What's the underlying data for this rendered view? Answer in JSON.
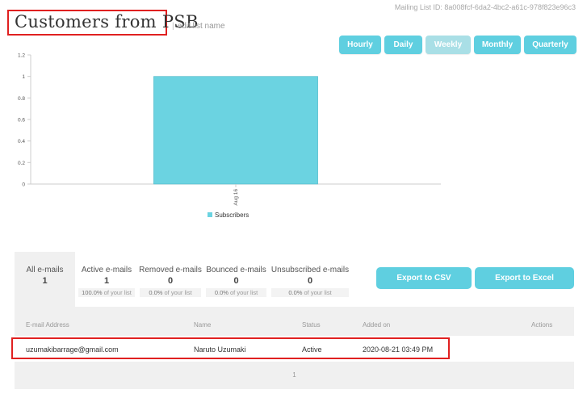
{
  "mailing_list_id": "Mailing List ID: 8a008fcf-6da2-4bc2-a61c-978f823e96c3",
  "title": "Customers from PSB",
  "edit_link": "edit list name",
  "period_buttons": [
    "Hourly",
    "Daily",
    "Weekly",
    "Monthly",
    "Quarterly"
  ],
  "period_active": "Weekly",
  "chart_data": {
    "type": "bar",
    "categories": [
      "Aug 16"
    ],
    "series": [
      {
        "name": "Subscribers",
        "values": [
          1
        ]
      }
    ],
    "ylim": [
      0,
      1.2
    ],
    "yticks": [
      "0",
      "0.2",
      "0.4",
      "0.6",
      "0.8",
      "1",
      "1.2"
    ],
    "legend": "bottom-center",
    "grid": false,
    "color": "#6bd3e1"
  },
  "tabs": [
    {
      "label": "All e-mails",
      "count": "1",
      "pct": "",
      "pct_suffix": ""
    },
    {
      "label": "Active e-mails",
      "count": "1",
      "pct": "100.0%",
      "pct_suffix": " of your list"
    },
    {
      "label": "Removed e-mails",
      "count": "0",
      "pct": "0.0%",
      "pct_suffix": " of your list"
    },
    {
      "label": "Bounced e-mails",
      "count": "0",
      "pct": "0.0%",
      "pct_suffix": " of your list"
    },
    {
      "label": "Unsubscribed e-mails",
      "count": "0",
      "pct": "0.0%",
      "pct_suffix": " of your list"
    }
  ],
  "export_csv": "Export to CSV",
  "export_excel": "Export to Excel",
  "columns": {
    "email": "E-mail Address",
    "name": "Name",
    "status": "Status",
    "added": "Added on",
    "actions": "Actions"
  },
  "rows": [
    {
      "email": "uzumakibarrage@gmail.com",
      "name": "Naruto Uzumaki",
      "status": "Active",
      "added": "2020-08-21 03:49 PM"
    }
  ],
  "pager": "1",
  "colors": {
    "accent": "#5fcfe0",
    "accent_inactive": "#a9dfe6",
    "highlight": "#e02020"
  }
}
